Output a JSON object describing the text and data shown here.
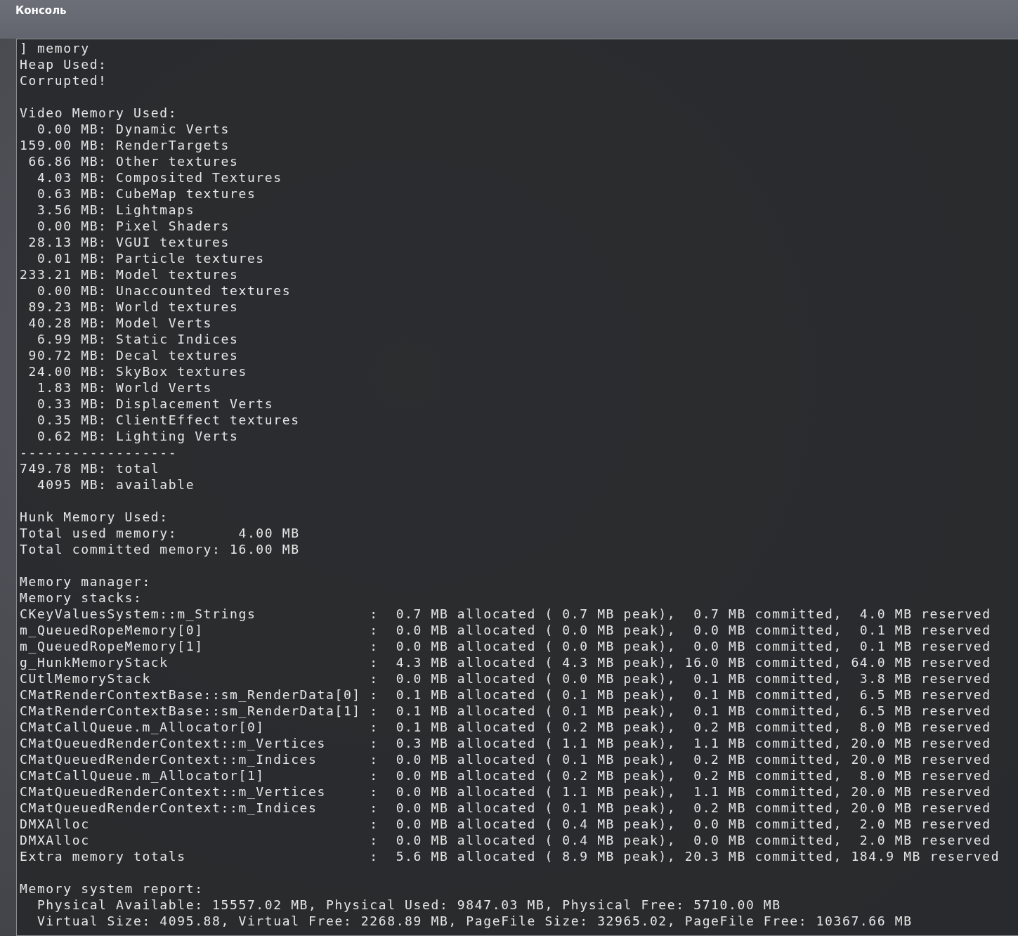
{
  "window": {
    "title": "Консоль"
  },
  "console": {
    "blocks": [
      [
        "] memory",
        "Heap Used:",
        "Corrupted!"
      ],
      [
        "Video Memory Used:",
        "  0.00 MB: Dynamic Verts",
        "159.00 MB: RenderTargets",
        " 66.86 MB: Other textures",
        "  4.03 MB: Composited Textures",
        "  0.63 MB: CubeMap textures",
        "  3.56 MB: Lightmaps",
        "  0.00 MB: Pixel Shaders",
        " 28.13 MB: VGUI textures",
        "  0.01 MB: Particle textures",
        "233.21 MB: Model textures",
        "  0.00 MB: Unaccounted textures",
        " 89.23 MB: World textures",
        " 40.28 MB: Model Verts",
        "  6.99 MB: Static Indices",
        " 90.72 MB: Decal textures",
        " 24.00 MB: SkyBox textures",
        "  1.83 MB: World Verts",
        "  0.33 MB: Displacement Verts",
        "  0.35 MB: ClientEffect textures",
        "  0.62 MB: Lighting Verts",
        "------------------",
        "749.78 MB: total",
        "  4095 MB: available"
      ],
      [
        "Hunk Memory Used:",
        "Total used memory:       4.00 MB",
        "Total committed memory: 16.00 MB"
      ],
      [
        "Memory manager:",
        "Memory stacks:",
        "CKeyValuesSystem::m_Strings             :  0.7 MB allocated ( 0.7 MB peak),  0.7 MB committed,  4.0 MB reserved",
        "m_QueuedRopeMemory[0]                   :  0.0 MB allocated ( 0.0 MB peak),  0.0 MB committed,  0.1 MB reserved",
        "m_QueuedRopeMemory[1]                   :  0.0 MB allocated ( 0.0 MB peak),  0.0 MB committed,  0.1 MB reserved",
        "g_HunkMemoryStack                       :  4.3 MB allocated ( 4.3 MB peak), 16.0 MB committed, 64.0 MB reserved",
        "CUtlMemoryStack                         :  0.0 MB allocated ( 0.0 MB peak),  0.1 MB committed,  3.8 MB reserved",
        "CMatRenderContextBase::sm_RenderData[0] :  0.1 MB allocated ( 0.1 MB peak),  0.1 MB committed,  6.5 MB reserved",
        "CMatRenderContextBase::sm_RenderData[1] :  0.1 MB allocated ( 0.1 MB peak),  0.1 MB committed,  6.5 MB reserved",
        "CMatCallQueue.m_Allocator[0]            :  0.1 MB allocated ( 0.2 MB peak),  0.2 MB committed,  8.0 MB reserved",
        "CMatQueuedRenderContext::m_Vertices     :  0.3 MB allocated ( 1.1 MB peak),  1.1 MB committed, 20.0 MB reserved",
        "CMatQueuedRenderContext::m_Indices      :  0.0 MB allocated ( 0.1 MB peak),  0.2 MB committed, 20.0 MB reserved",
        "CMatCallQueue.m_Allocator[1]            :  0.0 MB allocated ( 0.2 MB peak),  0.2 MB committed,  8.0 MB reserved",
        "CMatQueuedRenderContext::m_Vertices     :  0.0 MB allocated ( 1.1 MB peak),  1.1 MB committed, 20.0 MB reserved",
        "CMatQueuedRenderContext::m_Indices      :  0.0 MB allocated ( 0.1 MB peak),  0.2 MB committed, 20.0 MB reserved",
        "DMXAlloc                                :  0.0 MB allocated ( 0.4 MB peak),  0.0 MB committed,  2.0 MB reserved",
        "DMXAlloc                                :  0.0 MB allocated ( 0.4 MB peak),  0.0 MB committed,  2.0 MB reserved",
        "Extra memory totals                     :  5.6 MB allocated ( 8.9 MB peak), 20.3 MB committed, 184.9 MB reserved"
      ],
      [
        "Memory system report:",
        "  Physical Available: 15557.02 MB, Physical Used: 9847.03 MB, Physical Free: 5710.00 MB",
        "  Virtual Size: 4095.88, Virtual Free: 2268.89 MB, PageFile Size: 32965.02, PageFile Free: 10367.66 MB"
      ]
    ]
  }
}
